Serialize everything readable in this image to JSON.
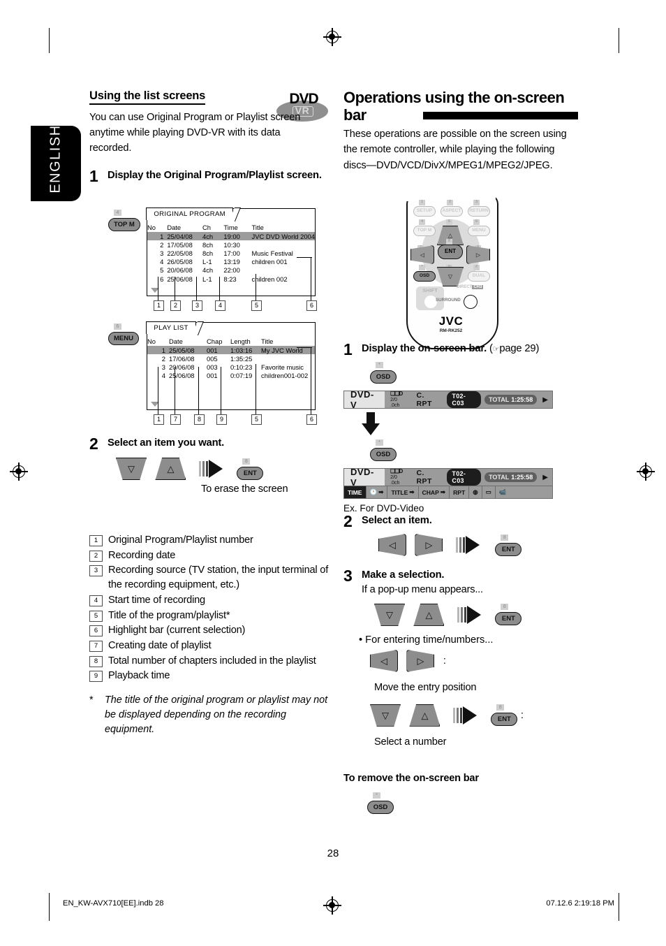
{
  "language_tab": "ENGLISH",
  "page_number": "28",
  "footer": {
    "file": "EN_KW-AVX710[EE].indb   28",
    "timestamp": "07.12.6   2:19:18 PM"
  },
  "disc_logo": {
    "top": "DVD",
    "bottom": "VR"
  },
  "left_column": {
    "heading": "Using the list screens",
    "intro": "You can use Original Program or Playlist screen anytime while playing DVD-VR with its data recorded.",
    "step1": {
      "num": "1",
      "text": "Display the Original Program/Playlist screen."
    },
    "original_program": {
      "button": {
        "label": "TOP M",
        "number": "4"
      },
      "title": "ORIGINAL PROGRAM",
      "columns": [
        "No",
        "Date",
        "Ch",
        "Time",
        "Title"
      ],
      "rows": [
        {
          "no": "1",
          "date": "25/04/08",
          "ch": "4ch",
          "time": "19:00",
          "title": "JVC DVD World 2004",
          "highlighted": true
        },
        {
          "no": "2",
          "date": "17/05/08",
          "ch": "8ch",
          "time": "10:30",
          "title": "",
          "highlighted": false
        },
        {
          "no": "3",
          "date": "22/05/08",
          "ch": "8ch",
          "time": "17:00",
          "title": "Music Festival",
          "highlighted": false
        },
        {
          "no": "4",
          "date": "26/05/08",
          "ch": "L-1",
          "time": "13:19",
          "title": "children 001",
          "highlighted": false
        },
        {
          "no": "5",
          "date": "20/06/08",
          "ch": "4ch",
          "time": "22:00",
          "title": "",
          "highlighted": false
        },
        {
          "no": "6",
          "date": "25/06/08",
          "ch": "L-1",
          "time": "8:23",
          "title": "children 002",
          "highlighted": false
        }
      ],
      "callouts": [
        "1",
        "2",
        "3",
        "4",
        "5",
        "6"
      ]
    },
    "play_list": {
      "button": {
        "label": "MENU",
        "number": "6"
      },
      "title": "PLAY LIST",
      "columns": [
        "No",
        "Date",
        "Chap",
        "Length",
        "Title"
      ],
      "rows": [
        {
          "no": "1",
          "date": "25/05/08",
          "chap": "001",
          "length": "1:03:16",
          "title": "My JVC World",
          "highlighted": true
        },
        {
          "no": "2",
          "date": "17/06/08",
          "chap": "005",
          "length": "1:35:25",
          "title": "",
          "highlighted": false
        },
        {
          "no": "3",
          "date": "20/06/08",
          "chap": "003",
          "length": "0:10:23",
          "title": "Favorite music",
          "highlighted": false
        },
        {
          "no": "4",
          "date": "25/06/08",
          "chap": "001",
          "length": "0:07:19",
          "title": "children001-002",
          "highlighted": false
        }
      ],
      "callouts": [
        "1",
        "7",
        "8",
        "9",
        "5",
        "6"
      ]
    },
    "step2": {
      "num": "2",
      "text": "Select an item you want.",
      "keys": {
        "down": "down-arrow",
        "up": "up-arrow",
        "ent": "ENT",
        "ent_number": "8"
      },
      "caption": "To erase the screen"
    },
    "legend": [
      {
        "num": "1",
        "text": "Original Program/Playlist number"
      },
      {
        "num": "2",
        "text": "Recording date"
      },
      {
        "num": "3",
        "text": "Recording source (TV station, the input terminal of the recording equipment, etc.)"
      },
      {
        "num": "4",
        "text": "Start time of recording"
      },
      {
        "num": "5",
        "text": "Title of the program/playlist*"
      },
      {
        "num": "6",
        "text": "Highlight bar (current selection)"
      },
      {
        "num": "7",
        "text": "Creating date of playlist"
      },
      {
        "num": "8",
        "text": "Total number of chapters included in the playlist"
      },
      {
        "num": "9",
        "text": "Playback time"
      }
    ],
    "footnote": {
      "marker": "*",
      "text": "The title of the original program or playlist may not be displayed depending on the recording equipment."
    }
  },
  "right_column": {
    "heading": "Operations using the on-screen bar",
    "intro": "These operations are possible on the screen using the remote controller, while playing the following discs—DVD/VCD/DivX/MPEG1/MPEG2/JPEG.",
    "remote": {
      "brand": "JVC",
      "model": "RM-RK252",
      "keys": [
        {
          "label": "SETUP",
          "number": "1"
        },
        {
          "label": "ASPECT",
          "number": "2"
        },
        {
          "label": "RETURN",
          "number": "3"
        },
        {
          "label": "TOP M",
          "number": "4"
        },
        {
          "label": "MENU",
          "number": "6"
        },
        {
          "label": "OSD",
          "number": "*"
        },
        {
          "label": "DUAL",
          "number": "#"
        }
      ],
      "nav": {
        "up": "5",
        "left": "7",
        "ent": "8",
        "right": "9",
        "down": "0",
        "ent_label": "ENT"
      },
      "shift": "SHIFT",
      "surround": "SURROUND",
      "direct": "DIRECT",
      "direct_badge": "CH3"
    },
    "step1": {
      "num": "1",
      "text": "Display the on-screen bar.",
      "ref": "page 29",
      "button": {
        "label": "OSD",
        "number": "*"
      }
    },
    "osbar": {
      "disc_type": "DVD-V",
      "audio_icon": "D",
      "audio_format": "2/0 .0ch",
      "repeat": "C. RPT",
      "chapter_chip": "T02-C03",
      "total_label": "TOTAL",
      "total_time": "1:25:58",
      "next_arrow": "▶",
      "second_row": [
        {
          "label": "TIME",
          "selected": true
        },
        {
          "label": "clock-icon ➡",
          "selected": false
        },
        {
          "label": "TITLE ➡",
          "selected": false
        },
        {
          "label": "CHAP ➡",
          "selected": false
        },
        {
          "label": "RPT",
          "selected": false
        },
        {
          "label": "audio-icon",
          "selected": false
        },
        {
          "label": "subtitle-icon",
          "selected": false
        },
        {
          "label": "angle-icon",
          "selected": false
        }
      ],
      "example_caption": "Ex. For DVD-Video"
    },
    "step2": {
      "num": "2",
      "text": "Select an item.",
      "ent_number": "8",
      "ent_label": "ENT"
    },
    "step3": {
      "num": "3",
      "text": "Make a selection.",
      "sub": "If a pop-up menu appears...",
      "bullet": "•  For entering time/numbers...",
      "move_caption": "Move the entry position",
      "select_caption": "Select a number",
      "ent_number": "8",
      "ent_label": "ENT",
      "colon": ":"
    },
    "remove_heading": "To remove the on-screen bar",
    "remove_button": {
      "label": "OSD",
      "number": "*"
    }
  }
}
